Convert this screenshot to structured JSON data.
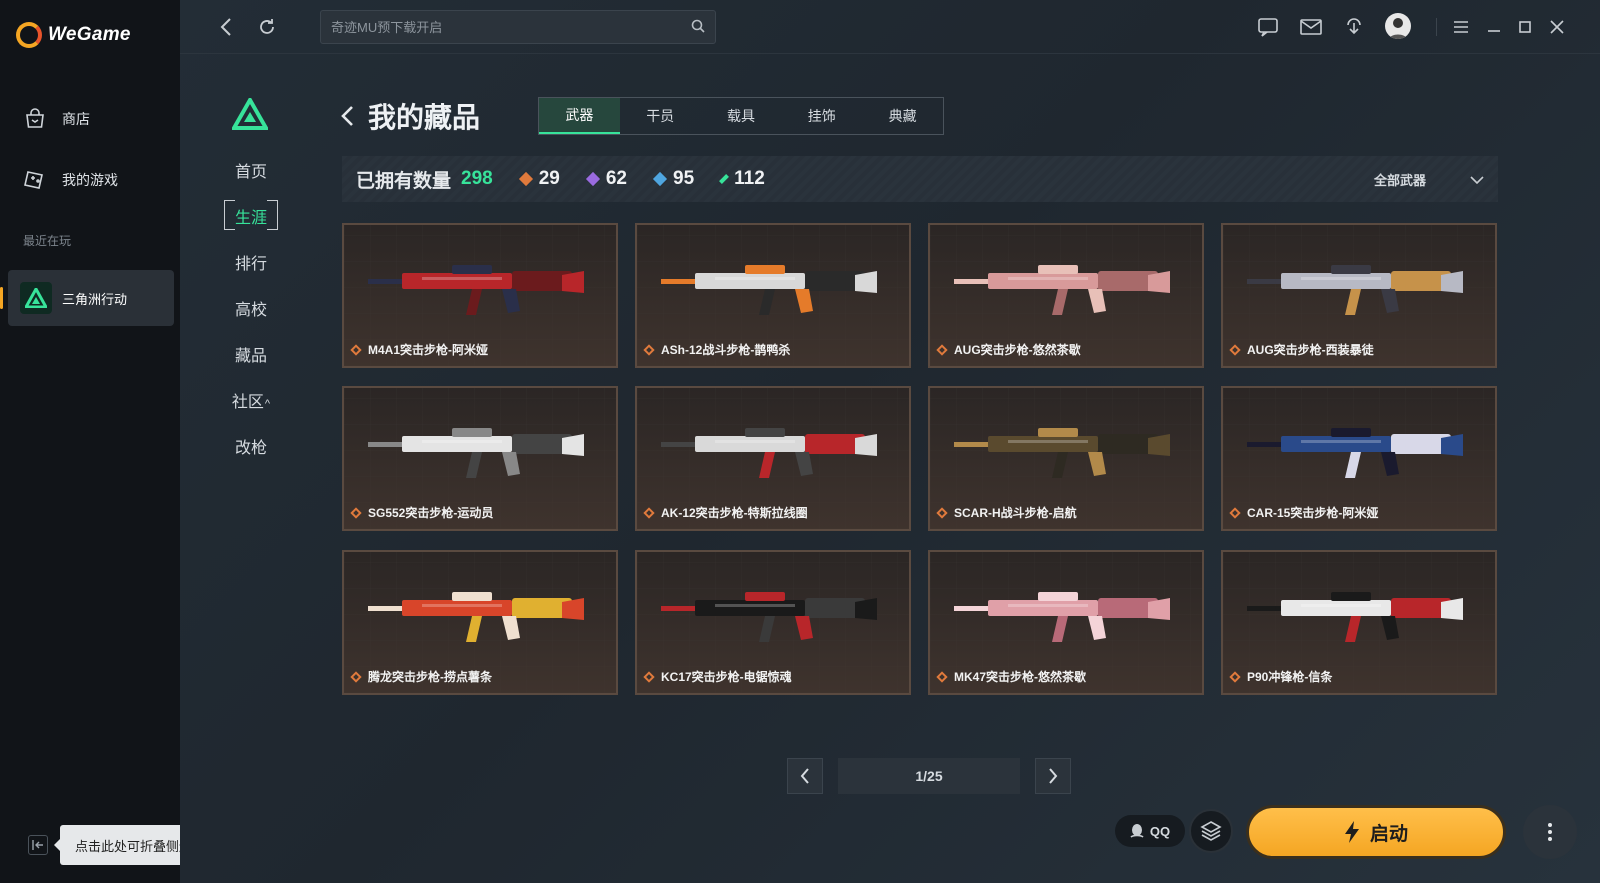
{
  "app": {
    "brand": "WeGame",
    "nav": [
      {
        "label": "商店",
        "icon": "store-bag-icon"
      },
      {
        "label": "我的游戏",
        "icon": "gamepad-icon"
      }
    ],
    "recent_label": "最近在玩",
    "recent_game": "三角洲行动",
    "collapse_tooltip": "点击此处可折叠侧边栏"
  },
  "topbar": {
    "search_placeholder": "奇迹MU预下载开启"
  },
  "game_nav": {
    "items": [
      "首页",
      "生涯",
      "排行",
      "高校",
      "藏品",
      "社区",
      "改枪"
    ],
    "active": "生涯",
    "community_caret": "^"
  },
  "page": {
    "title": "我的藏品",
    "tabs": [
      "武器",
      "干员",
      "载具",
      "挂饰",
      "典藏"
    ],
    "active_tab": "武器"
  },
  "stats": {
    "label": "已拥有数量",
    "total": "298",
    "rarities": [
      {
        "count": "29",
        "color": "#e07a3c"
      },
      {
        "count": "62",
        "color": "#9a6be0"
      },
      {
        "count": "95",
        "color": "#4fa6e0"
      },
      {
        "count": "112",
        "color": "#37e39a"
      }
    ],
    "filter_label": "全部武器"
  },
  "items": [
    {
      "name": "M4A1突击步枪-阿米娅",
      "palette": [
        "#b8262a",
        "#6b1b1d",
        "#2a2f4a"
      ]
    },
    {
      "name": "ASh-12战斗步枪-鹊鸭杀",
      "palette": [
        "#d8d8d8",
        "#2a2a2a",
        "#e57b2a"
      ]
    },
    {
      "name": "AUG突击步枪-悠然茶歇",
      "palette": [
        "#d89a9a",
        "#a86a6a",
        "#e8c0b8"
      ]
    },
    {
      "name": "AUG突击步枪-西装暴徒",
      "palette": [
        "#b7b9c4",
        "#c6924a",
        "#3a3a44"
      ]
    },
    {
      "name": "SG552突击步枪-运动员",
      "palette": [
        "#e4e4e4",
        "#444444",
        "#888888"
      ]
    },
    {
      "name": "AK-12突击步枪-特斯拉线圈",
      "palette": [
        "#d9d9d9",
        "#b8262a",
        "#444444"
      ]
    },
    {
      "name": "SCAR-H战斗步枪-启航",
      "palette": [
        "#5a4a2e",
        "#2e2a22",
        "#b28a4a"
      ]
    },
    {
      "name": "CAR-15突击步枪-阿米娅",
      "palette": [
        "#2a4a8a",
        "#d8d8e8",
        "#1a1a2e"
      ]
    },
    {
      "name": "腾龙突击步枪-捞点薯条",
      "palette": [
        "#d8452a",
        "#e0b030",
        "#f0e0d0"
      ]
    },
    {
      "name": "KC17突击步枪-电锯惊魂",
      "palette": [
        "#1a1a1a",
        "#3a3a3a",
        "#b8262a"
      ]
    },
    {
      "name": "MK47突击步枪-悠然茶歇",
      "palette": [
        "#e0a0a8",
        "#b86a78",
        "#f4d4d8"
      ]
    },
    {
      "name": "P90冲锋枪-信条",
      "palette": [
        "#e8e8e8",
        "#b8262a",
        "#1a1a1a"
      ]
    }
  ],
  "pager": {
    "page": "1/25"
  },
  "bottom": {
    "qq_label": "QQ",
    "launch_label": "启动"
  }
}
